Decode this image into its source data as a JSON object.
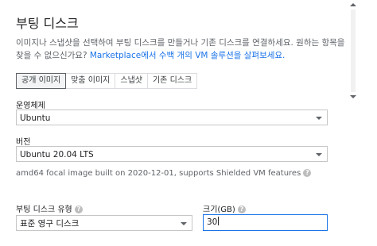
{
  "title": "부팅 디스크",
  "description": {
    "part1": "이미지나 스냅샷을 선택하여 부팅 디스크를 만들거나 기존 디스크를 연결하세요. 원하는 항목을 찾을 수 없으신가요? ",
    "link": "Marketplace에서 수백 개의 VM 솔루션을 살펴보세요."
  },
  "tabs": [
    {
      "label": "공개 이미지",
      "active": true
    },
    {
      "label": "맞춤 이미지",
      "active": false
    },
    {
      "label": "스냅샷",
      "active": false
    },
    {
      "label": "기존 디스크",
      "active": false
    }
  ],
  "os": {
    "label": "운영체제",
    "value": "Ubuntu"
  },
  "version": {
    "label": "버전",
    "value": "Ubuntu 20.04 LTS"
  },
  "version_note": "amd64 focal image built on 2020-12-01, supports Shielded VM features",
  "disk_type": {
    "label": "부팅 디스크 유형",
    "value": "표준 영구 디스크"
  },
  "size": {
    "label": "크기(GB)",
    "value": "30"
  },
  "help_icon": "?",
  "colors": {
    "accent": "#1a73e8",
    "text": "#202124",
    "secondary": "#5f6368"
  }
}
